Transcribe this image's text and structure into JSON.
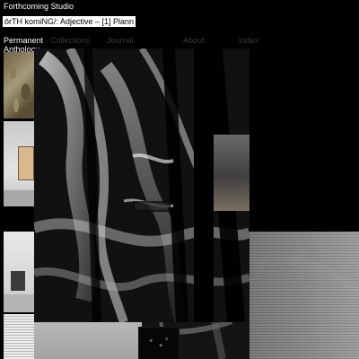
{
  "header": {
    "studio_title": "Forthcoming Studio",
    "subtitle": "ôrTH  komiNG/: Adjective – [1] Plann"
  },
  "nav": {
    "items": [
      {
        "label": "Permanent",
        "label2": "Anthology"
      },
      {
        "label": "Collections"
      },
      {
        "label": "Journal"
      },
      {
        "label": "About"
      },
      {
        "label": "Index"
      }
    ]
  }
}
